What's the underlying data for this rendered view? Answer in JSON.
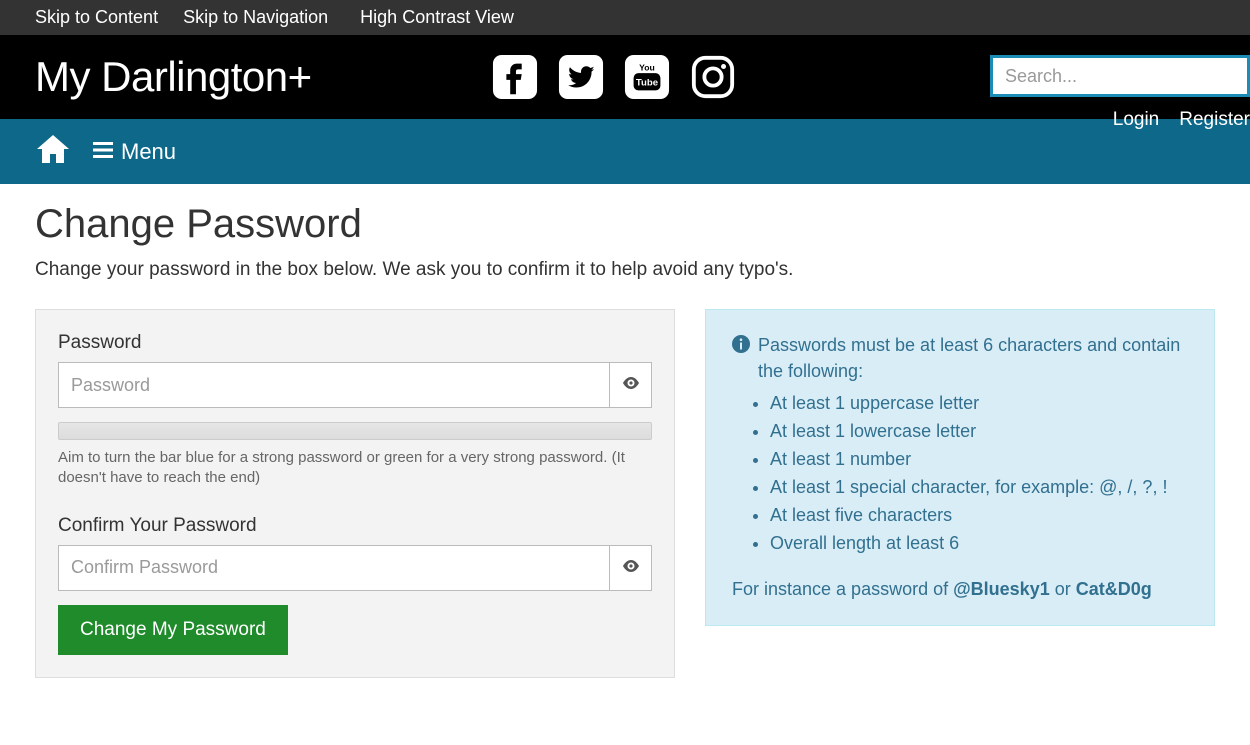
{
  "skipbar": {
    "skip_content": "Skip to Content",
    "skip_nav": "Skip to Navigation",
    "high_contrast": "High Contrast View"
  },
  "header": {
    "logo": "My Darlington+",
    "search_placeholder": "Search...",
    "login": "Login",
    "register": "Register"
  },
  "nav": {
    "menu": "Menu"
  },
  "page": {
    "title": "Change Password",
    "lead": "Change your password in the box below. We ask you to confirm it to help avoid any typo's."
  },
  "form": {
    "password_label": "Password",
    "password_placeholder": "Password",
    "strength_hint": "Aim to turn the bar blue for a strong password or green for a very strong password. (It doesn't have to reach the end)",
    "confirm_label": "Confirm Your Password",
    "confirm_placeholder": "Confirm Password",
    "submit": "Change My Password"
  },
  "info": {
    "intro": "Passwords must be at least 6 characters and contain the following:",
    "rules": [
      "At least 1 uppercase letter",
      "At least 1 lowercase letter",
      "At least 1 number",
      "At least 1 special character, for example: @, /, ?, !",
      "At least five characters",
      "Overall length at least 6"
    ],
    "example_prefix": "For instance a password of ",
    "example_1": "@Bluesky1",
    "example_or": " or ",
    "example_2": "Cat&D0g"
  }
}
